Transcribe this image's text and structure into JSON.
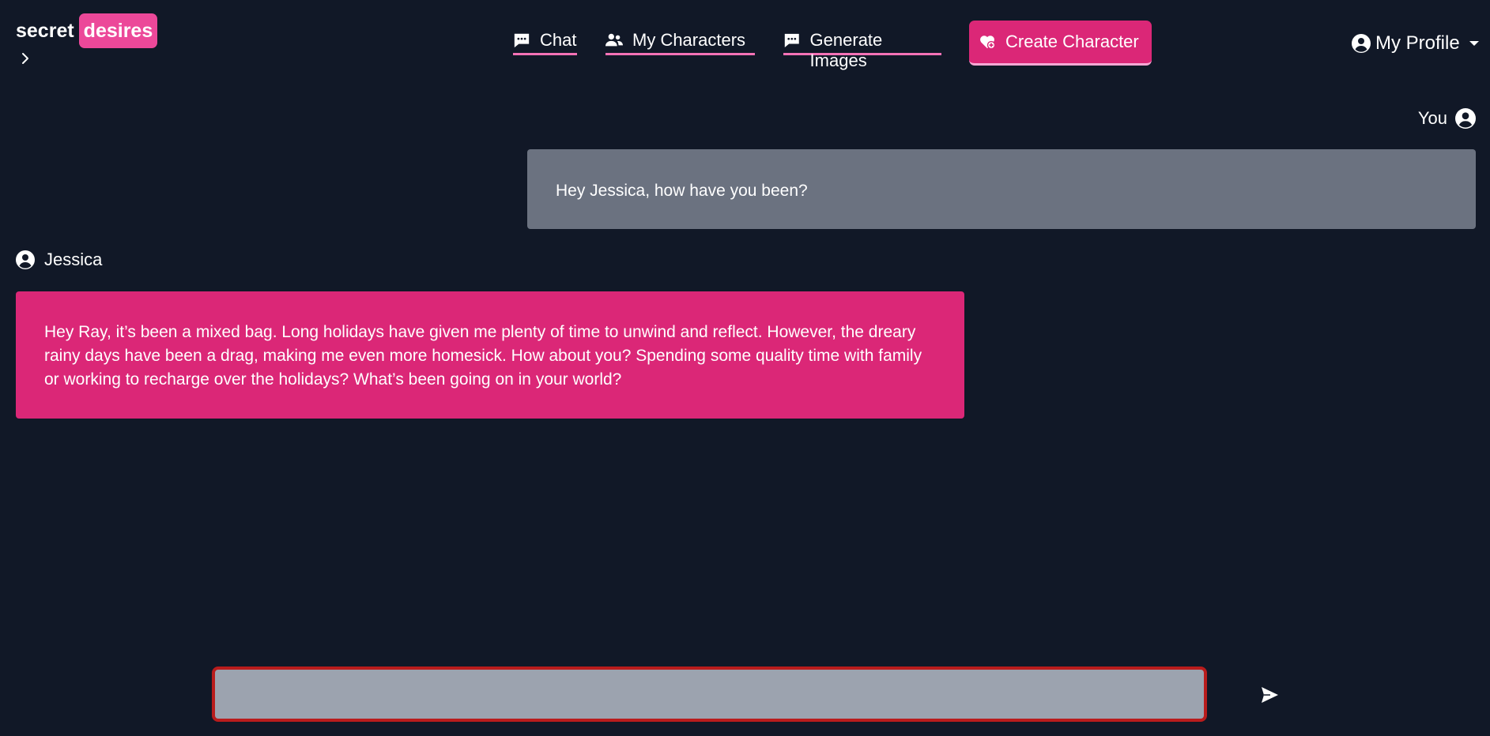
{
  "brand": {
    "word1": "secret",
    "word2": "desires",
    "accent": "#ec4899"
  },
  "nav": {
    "chat": {
      "label": "Chat",
      "icon": "chat-bubble-icon"
    },
    "my_characters": {
      "label": "My Characters",
      "icon": "users-icon"
    },
    "generate_images": {
      "label": "Generate Images",
      "icon": "chat-bubble-icon"
    },
    "create_character": {
      "label": "Create Character",
      "icon": "heart-plus-icon"
    },
    "profile": {
      "label": "My Profile",
      "icon": "user-circle-icon"
    }
  },
  "conversation": {
    "user_name": "You",
    "bot_name": "Jessica",
    "messages": [
      {
        "sender": "You",
        "text": "Hey Jessica, how have you been?"
      },
      {
        "sender": "Jessica",
        "text": "Hey Ray, it’s been a mixed bag. Long holidays have given me plenty of time to unwind and reflect. However, the dreary rainy days have been a drag, making me even more homesick. How about you? Spending some quality time with family or working to recharge over the holidays? What’s been going on in your world?"
      }
    ]
  },
  "composer": {
    "value": "",
    "placeholder": ""
  },
  "colors": {
    "background": "#111827",
    "user_bubble": "#6b7280",
    "bot_bubble": "#db2777",
    "input_border": "#b91c1c"
  }
}
